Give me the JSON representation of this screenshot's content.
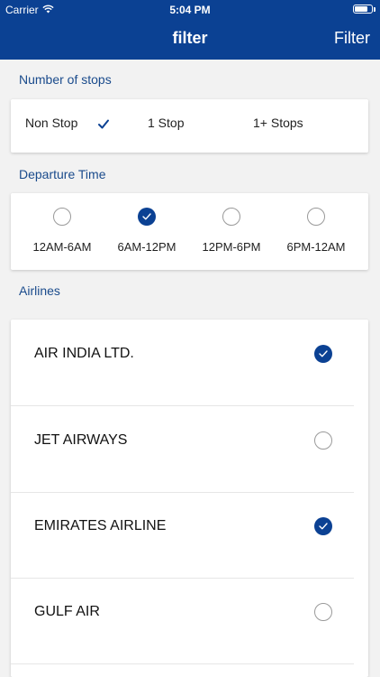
{
  "status": {
    "carrier": "Carrier",
    "time": "5:04 PM",
    "battery_level": 0.75
  },
  "nav": {
    "title": "filter",
    "right_action": "Filter"
  },
  "colors": {
    "brand": "#0b4193",
    "section_label": "#1a4b8c"
  },
  "stops": {
    "section_label": "Number of stops",
    "options": [
      {
        "label": "Non Stop",
        "selected": true
      },
      {
        "label": "1 Stop",
        "selected": false
      },
      {
        "label": "1+ Stops",
        "selected": false
      }
    ]
  },
  "departure": {
    "section_label": "Departure Time",
    "options": [
      {
        "label": "12AM-6AM",
        "selected": false
      },
      {
        "label": "6AM-12PM",
        "selected": true
      },
      {
        "label": "12PM-6PM",
        "selected": false
      },
      {
        "label": "6PM-12AM",
        "selected": false
      }
    ]
  },
  "airlines": {
    "section_label": "Airlines",
    "items": [
      {
        "name": "AIR INDIA LTD.",
        "selected": true
      },
      {
        "name": "JET AIRWAYS",
        "selected": false
      },
      {
        "name": "EMIRATES AIRLINE",
        "selected": true
      },
      {
        "name": "GULF AIR",
        "selected": false
      }
    ]
  }
}
